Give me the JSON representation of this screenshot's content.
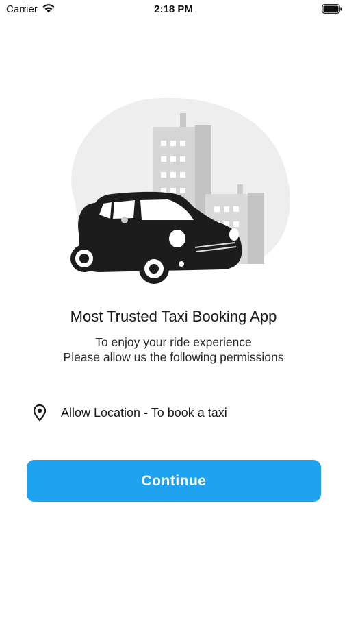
{
  "status_bar": {
    "carrier": "Carrier",
    "time": "2:18 PM"
  },
  "onboarding": {
    "title": "Most Trusted Taxi Booking App",
    "subtitle_line1": "To enjoy your ride experience",
    "subtitle_line2": "Please allow us the following permissions",
    "permissions": [
      {
        "icon": "location-pin-icon",
        "label": "Allow Location - To book a taxi"
      }
    ],
    "continue_label": "Continue"
  },
  "colors": {
    "accent": "#1fa2f0",
    "text": "#1b1b1b",
    "background": "#ffffff"
  }
}
